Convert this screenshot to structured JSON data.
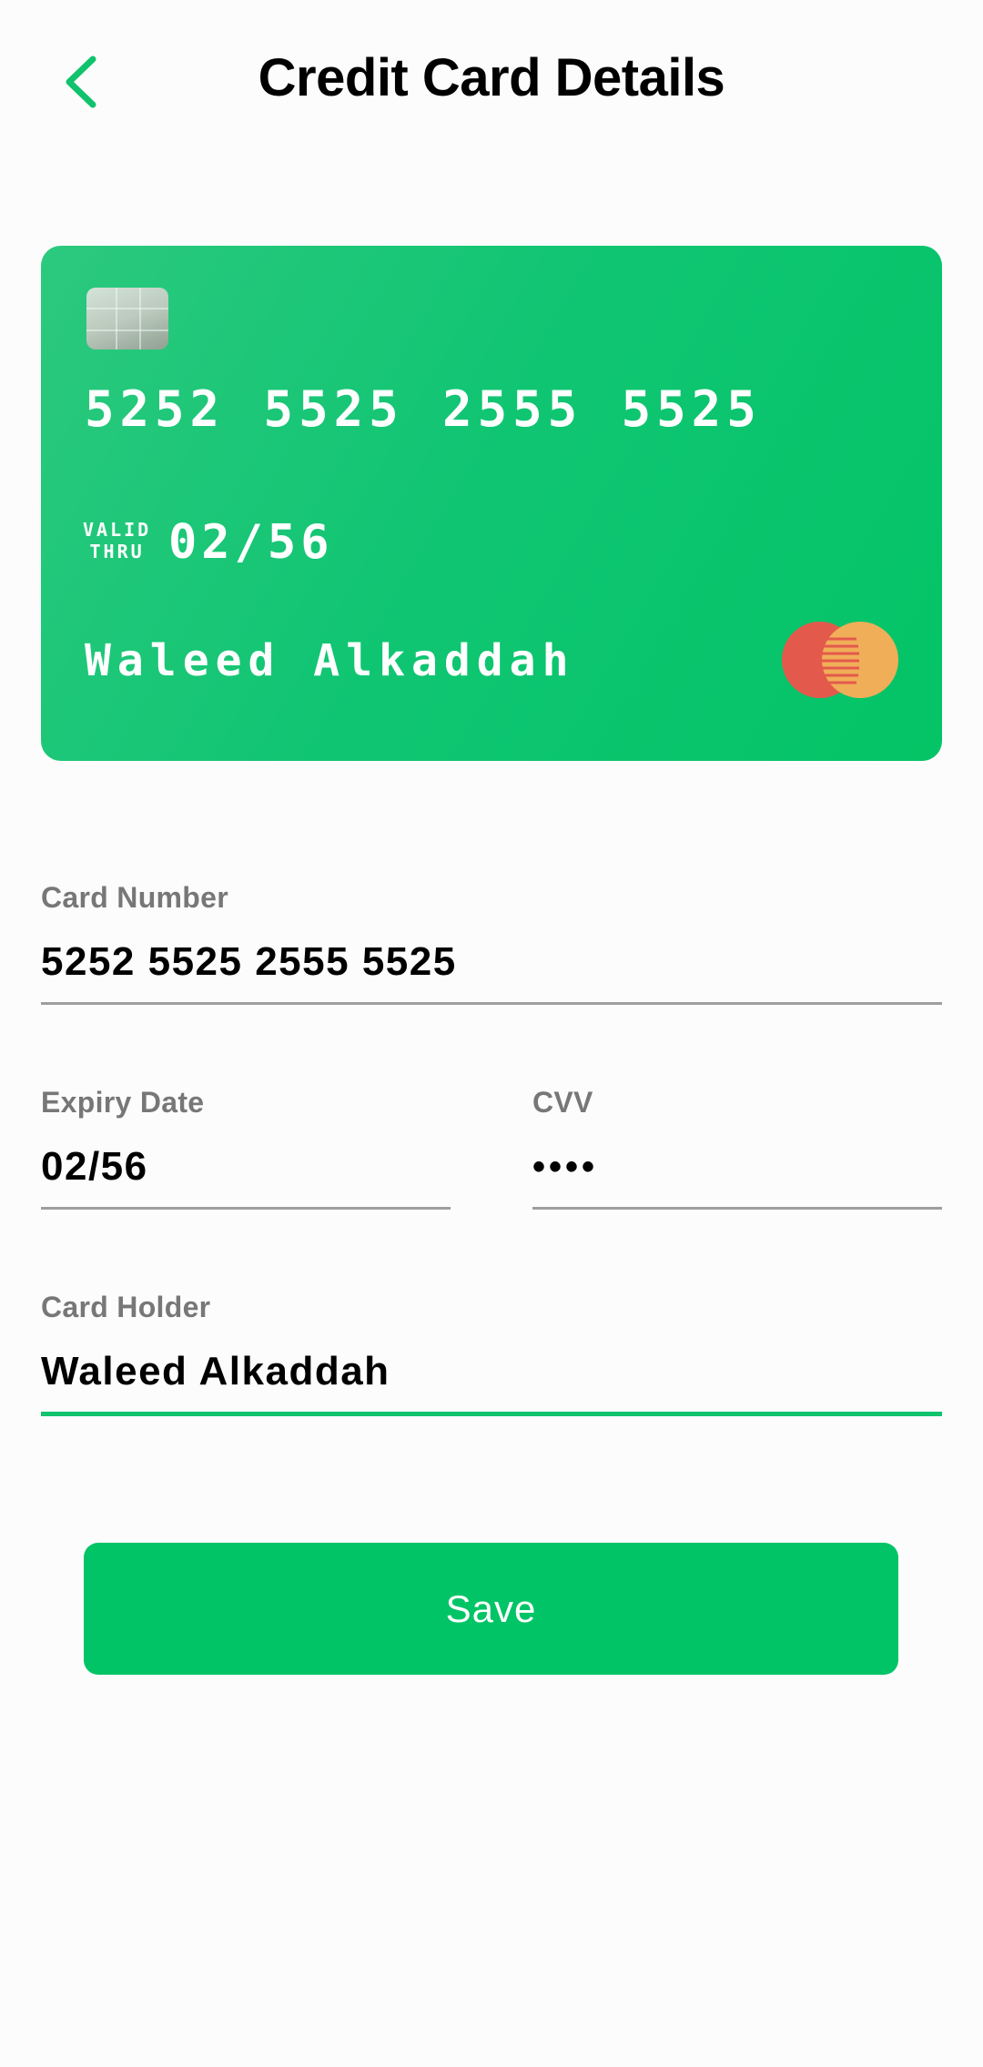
{
  "header": {
    "title": "Credit Card Details",
    "back_icon": "chevron-left-icon"
  },
  "card_preview": {
    "number": "5252 5525 2555 5525",
    "valid_thru_line1": "VALID",
    "valid_thru_line2": "THRU",
    "expiry": "02/56",
    "holder": "Waleed Alkaddah",
    "brand_logo": "mastercard-logo",
    "background_color": "#0dc46d"
  },
  "form": {
    "card_number": {
      "label": "Card Number",
      "value": "5252 5525 2555 5525"
    },
    "expiry_date": {
      "label": "Expiry Date",
      "value": "02/56"
    },
    "cvv": {
      "label": "CVV",
      "value": "••••"
    },
    "card_holder": {
      "label": "Card Holder",
      "value": "Waleed Alkaddah",
      "focused": true
    }
  },
  "actions": {
    "save_label": "Save"
  },
  "colors": {
    "accent": "#00c466",
    "label_gray": "#777777",
    "underline_gray": "#9e9e9e"
  }
}
